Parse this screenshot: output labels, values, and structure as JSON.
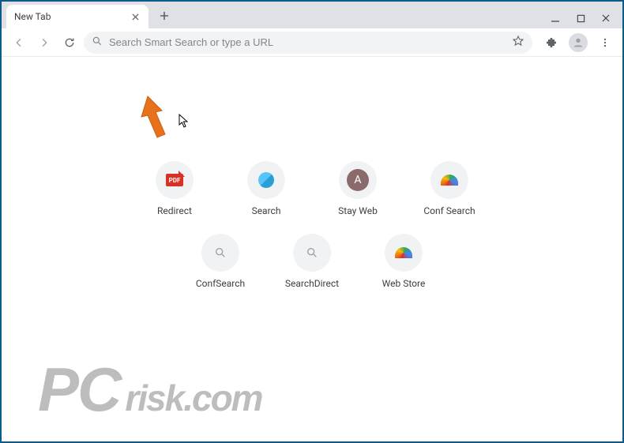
{
  "tab": {
    "title": "New Tab"
  },
  "omnibox": {
    "placeholder": "Search Smart Search or type a URL"
  },
  "shortcuts": [
    {
      "label": "Redirect",
      "icon": "pdf"
    },
    {
      "label": "Search",
      "icon": "blue"
    },
    {
      "label": "Stay Web",
      "icon": "letter",
      "letter": "A"
    },
    {
      "label": "Conf Search",
      "icon": "rainbow"
    },
    {
      "label": "ConfSearch",
      "icon": "mag"
    },
    {
      "label": "SearchDirect",
      "icon": "mag"
    },
    {
      "label": "Web Store",
      "icon": "rainbow"
    }
  ],
  "watermark": {
    "pc": "PC",
    "rest": "risk.com"
  }
}
